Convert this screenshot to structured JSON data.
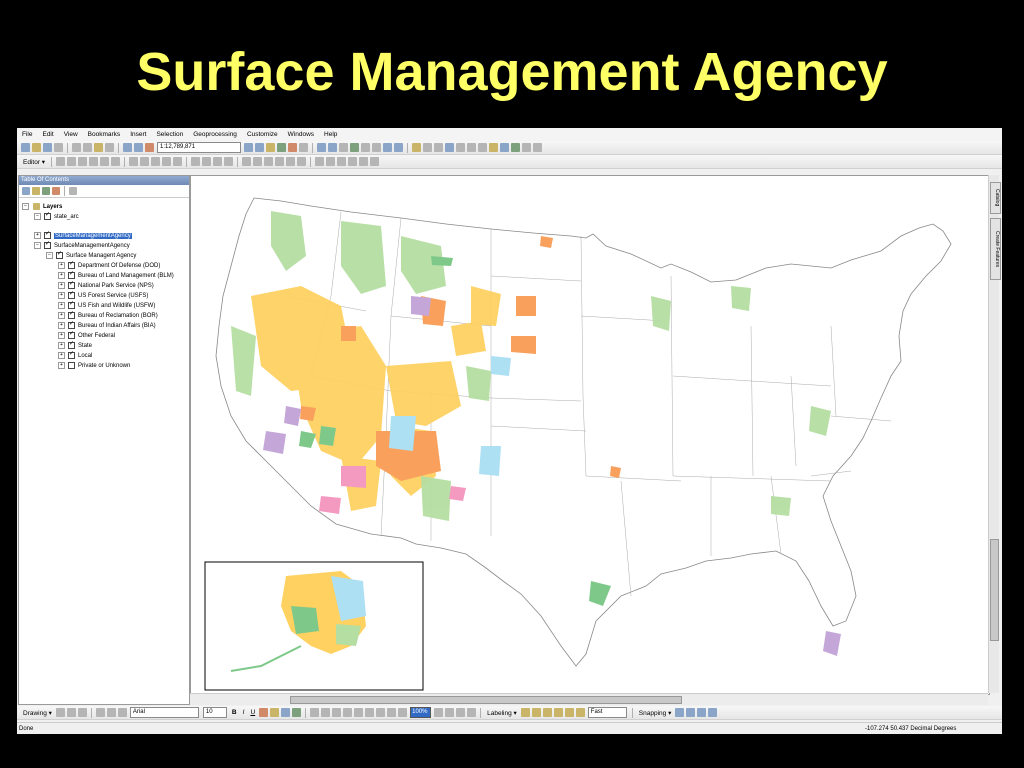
{
  "slide": {
    "title": "Surface Management Agency"
  },
  "app": {
    "menus": [
      "File",
      "Edit",
      "View",
      "Bookmarks",
      "Insert",
      "Selection",
      "Geoprocessing",
      "Customize",
      "Windows",
      "Help"
    ],
    "scale": "1:12,789,871",
    "editor_label": "Editor ▾"
  },
  "toc": {
    "title": "Table Of Contents",
    "layers_label": "Layers",
    "state_arc": "state_arc",
    "sma_selected": "SurfaceManagementAgency",
    "sma_group": "SurfaceManagementAgency",
    "sma_sub": "Surface Managent Agency",
    "agencies": [
      {
        "label": "Department Of Defense (DOD)",
        "color": "#f49ac1"
      },
      {
        "label": "Bureau of Land Management (BLM)",
        "color": "#fed161"
      },
      {
        "label": "National Park Service (NPS)",
        "color": "#c4a7d8"
      },
      {
        "label": "US Forest Service (USFS)",
        "color": "#b5dea2"
      },
      {
        "label": "US Fish and Wildlife (USFW)",
        "color": "#7ec98a"
      },
      {
        "label": "Bureau of Reclamation (BOR)",
        "color": "#eae6a0"
      },
      {
        "label": "Bureau of Indian Affairs (BIA)",
        "color": "#f9a05c"
      },
      {
        "label": "Other Federal",
        "color": "#dcdcdc"
      },
      {
        "label": "State",
        "color": "#aee0f4"
      },
      {
        "label": "Local",
        "color": "#c9e9b4"
      },
      {
        "label": "Private or Unknown",
        "color": "#ffffff"
      }
    ]
  },
  "side_tabs": {
    "catalog": "Catalog",
    "create_features": "Create Features"
  },
  "bottom_toolbar": {
    "drawing": "Drawing ▾",
    "font": "Arial",
    "font_size": "10",
    "bold": "B",
    "italic": "I",
    "underline": "U",
    "zoom": "100%",
    "labeling": "Labeling ▾",
    "fast": "Fast",
    "snapping": "Snapping ▾"
  },
  "status": {
    "left": "Done",
    "coords": "-107.274  50.437 Decimal Degrees"
  }
}
